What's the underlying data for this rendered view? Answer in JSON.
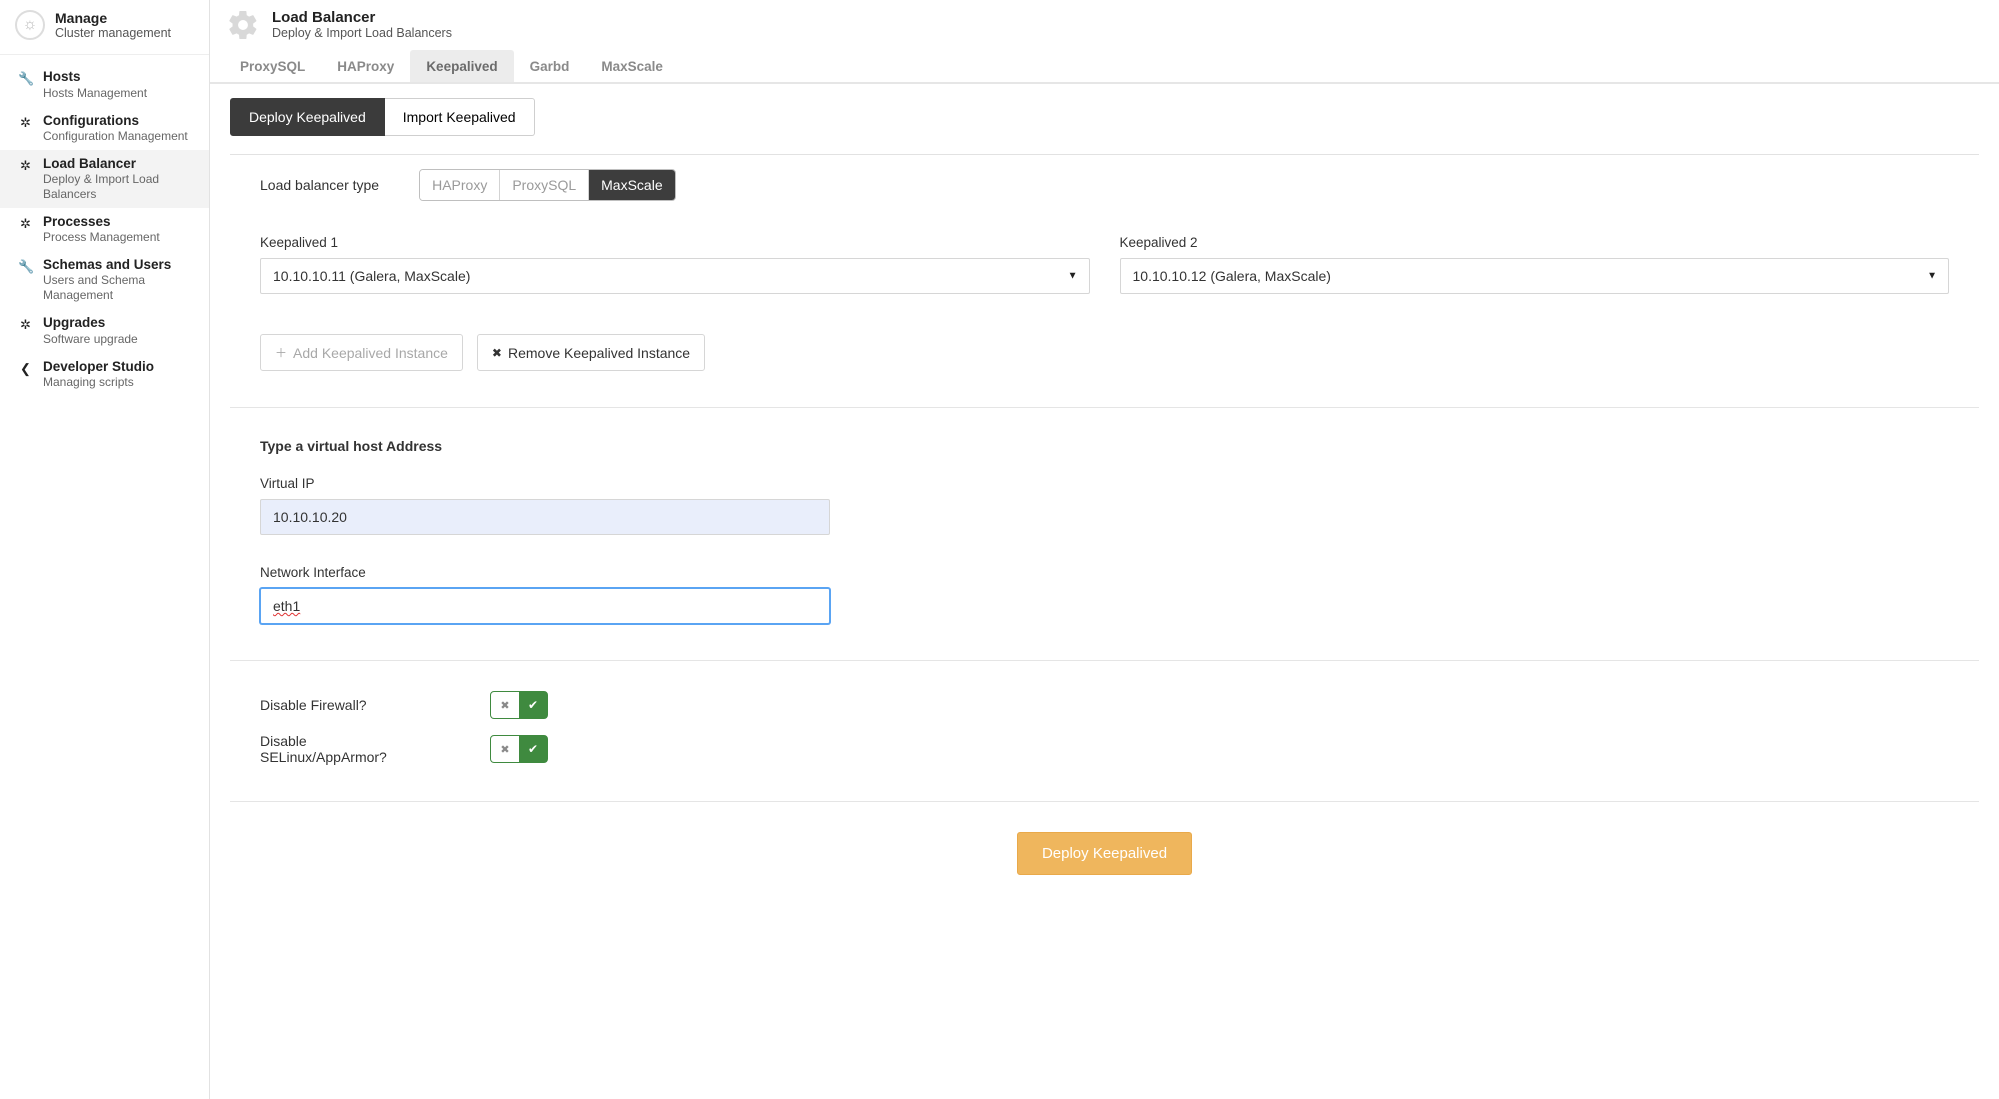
{
  "sidebar": {
    "header": {
      "title": "Manage",
      "subtitle": "Cluster management"
    },
    "items": [
      {
        "icon": "wrench-icon",
        "title": "Hosts",
        "subtitle": "Hosts Management"
      },
      {
        "icon": "gear-icon",
        "title": "Configurations",
        "subtitle": "Configuration Management"
      },
      {
        "icon": "gear-icon",
        "title": "Load Balancer",
        "subtitle": "Deploy & Import Load Balancers",
        "active": true
      },
      {
        "icon": "gear-icon",
        "title": "Processes",
        "subtitle": "Process Management"
      },
      {
        "icon": "wrench-icon",
        "title": "Schemas and Users",
        "subtitle": "Users and Schema Management"
      },
      {
        "icon": "gear-icon",
        "title": "Upgrades",
        "subtitle": "Software upgrade"
      },
      {
        "icon": "angle-left-icon",
        "title": "Developer Studio",
        "subtitle": "Managing scripts"
      }
    ]
  },
  "page": {
    "title": "Load Balancer",
    "subtitle": "Deploy & Import Load Balancers"
  },
  "tabs": {
    "items": [
      "ProxySQL",
      "HAProxy",
      "Keepalived",
      "Garbd",
      "MaxScale"
    ],
    "active": "Keepalived"
  },
  "subtabs": {
    "items": [
      "Deploy Keepalived",
      "Import Keepalived"
    ],
    "active": "Deploy Keepalived"
  },
  "form": {
    "lb_type_label": "Load balancer type",
    "lb_types": [
      "HAProxy",
      "ProxySQL",
      "MaxScale"
    ],
    "lb_type_selected": "MaxScale",
    "keepalived1_label": "Keepalived 1",
    "keepalived1_value": "10.10.10.11 (Galera, MaxScale)",
    "keepalived2_label": "Keepalived 2",
    "keepalived2_value": "10.10.10.12 (Galera, MaxScale)",
    "add_instance_label": "Add Keepalived Instance",
    "remove_instance_label": "Remove Keepalived Instance",
    "vhost_header": "Type a virtual host Address",
    "virtual_ip_label": "Virtual IP",
    "virtual_ip_value": "10.10.10.20",
    "net_iface_label": "Network Interface",
    "net_iface_value": "eth1",
    "disable_firewall_label": "Disable Firewall?",
    "disable_selinux_label": "Disable SELinux/AppArmor?",
    "deploy_button_label": "Deploy Keepalived"
  }
}
